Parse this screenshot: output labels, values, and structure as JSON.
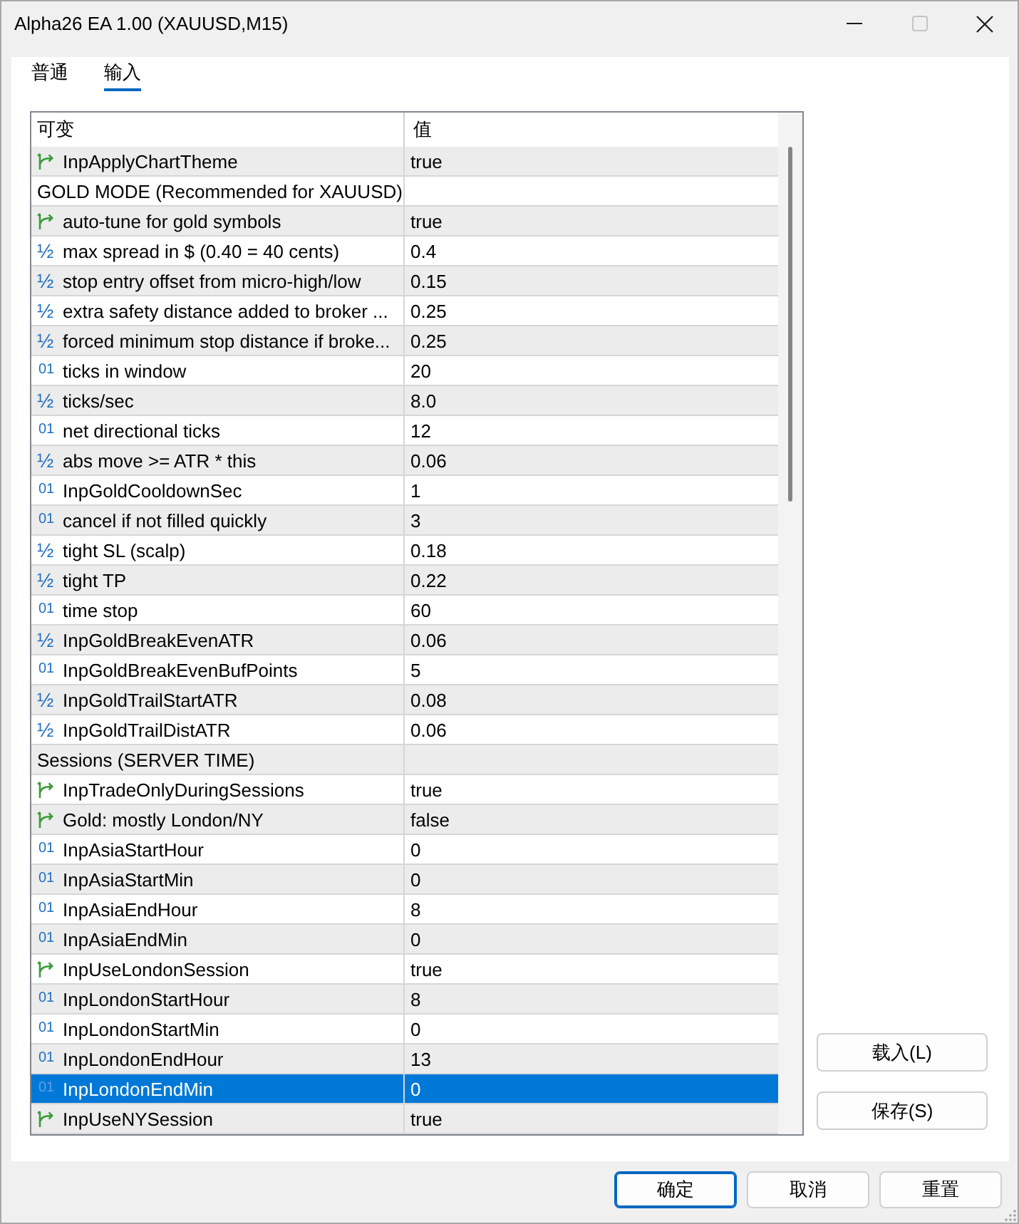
{
  "window": {
    "title": "Alpha26 EA 1.00 (XAUUSD,M15)",
    "maximize_disabled": true
  },
  "tabs": [
    {
      "label": "普通",
      "selected": false
    },
    {
      "label": "输入",
      "selected": true
    }
  ],
  "table": {
    "columns": [
      "可变",
      "值"
    ],
    "rows": [
      {
        "kind": "bool",
        "name": "InpApplyChartTheme",
        "value": "true",
        "selected": false
      },
      {
        "kind": "group",
        "name": "GOLD MODE (Recommended for XAUUSD)",
        "selected": false
      },
      {
        "kind": "bool",
        "name": "auto-tune for gold symbols",
        "value": "true",
        "selected": false
      },
      {
        "kind": "double",
        "type_mark": "½",
        "name": "max spread in $ (0.40 = 40 cents)",
        "value": "0.4",
        "selected": false
      },
      {
        "kind": "double",
        "type_mark": "½",
        "name": "stop entry offset from micro-high/low",
        "value": "0.15",
        "selected": false
      },
      {
        "kind": "double",
        "type_mark": "½",
        "name": "extra safety distance added to broker ...",
        "value": "0.25",
        "selected": false
      },
      {
        "kind": "double",
        "type_mark": "½",
        "name": "forced minimum stop distance if broke...",
        "value": "0.25",
        "selected": false
      },
      {
        "kind": "int",
        "type_mark": "01",
        "name": "ticks in window",
        "value": "20",
        "selected": false
      },
      {
        "kind": "double",
        "type_mark": "½",
        "name": "ticks/sec",
        "value": "8.0",
        "selected": false
      },
      {
        "kind": "int",
        "type_mark": "01",
        "name": "net directional ticks",
        "value": "12",
        "selected": false
      },
      {
        "kind": "double",
        "type_mark": "½",
        "name": "abs move >= ATR * this",
        "value": "0.06",
        "selected": false
      },
      {
        "kind": "int",
        "type_mark": "01",
        "name": "InpGoldCooldownSec",
        "value": "1",
        "selected": false
      },
      {
        "kind": "int",
        "type_mark": "01",
        "name": "cancel if not filled quickly",
        "value": "3",
        "selected": false
      },
      {
        "kind": "double",
        "type_mark": "½",
        "name": "tight SL (scalp)",
        "value": "0.18",
        "selected": false
      },
      {
        "kind": "double",
        "type_mark": "½",
        "name": "tight TP",
        "value": "0.22",
        "selected": false
      },
      {
        "kind": "int",
        "type_mark": "01",
        "name": "time stop",
        "value": "60",
        "selected": false
      },
      {
        "kind": "double",
        "type_mark": "½",
        "name": "InpGoldBreakEvenATR",
        "value": "0.06",
        "selected": false
      },
      {
        "kind": "int",
        "type_mark": "01",
        "name": "InpGoldBreakEvenBufPoints",
        "value": "5",
        "selected": false
      },
      {
        "kind": "double",
        "type_mark": "½",
        "name": "InpGoldTrailStartATR",
        "value": "0.08",
        "selected": false
      },
      {
        "kind": "double",
        "type_mark": "½",
        "name": "InpGoldTrailDistATR",
        "value": "0.06",
        "selected": false
      },
      {
        "kind": "group",
        "name": "Sessions (SERVER TIME)",
        "selected": false
      },
      {
        "kind": "bool",
        "name": "InpTradeOnlyDuringSessions",
        "value": "true",
        "selected": false
      },
      {
        "kind": "bool",
        "name": "Gold: mostly London/NY",
        "value": "false",
        "selected": false
      },
      {
        "kind": "int",
        "type_mark": "01",
        "name": "InpAsiaStartHour",
        "value": "0",
        "selected": false
      },
      {
        "kind": "int",
        "type_mark": "01",
        "name": "InpAsiaStartMin",
        "value": "0",
        "selected": false
      },
      {
        "kind": "int",
        "type_mark": "01",
        "name": "InpAsiaEndHour",
        "value": "8",
        "selected": false
      },
      {
        "kind": "int",
        "type_mark": "01",
        "name": "InpAsiaEndMin",
        "value": "0",
        "selected": false
      },
      {
        "kind": "bool",
        "name": "InpUseLondonSession",
        "value": "true",
        "selected": false
      },
      {
        "kind": "int",
        "type_mark": "01",
        "name": "InpLondonStartHour",
        "value": "8",
        "selected": false
      },
      {
        "kind": "int",
        "type_mark": "01",
        "name": "InpLondonStartMin",
        "value": "0",
        "selected": false
      },
      {
        "kind": "int",
        "type_mark": "01",
        "name": "InpLondonEndHour",
        "value": "13",
        "selected": false
      },
      {
        "kind": "int",
        "type_mark": "01",
        "name": "InpLondonEndMin",
        "value": "0",
        "selected": true
      },
      {
        "kind": "bool",
        "name": "InpUseNYSession",
        "value": "true",
        "selected": false
      }
    ]
  },
  "side_buttons": [
    "载入(L)",
    "保存(S)"
  ],
  "buttons": [
    {
      "label": "确定",
      "default": true
    },
    {
      "label": "取消",
      "default": false
    },
    {
      "label": "重置",
      "default": false
    }
  ]
}
